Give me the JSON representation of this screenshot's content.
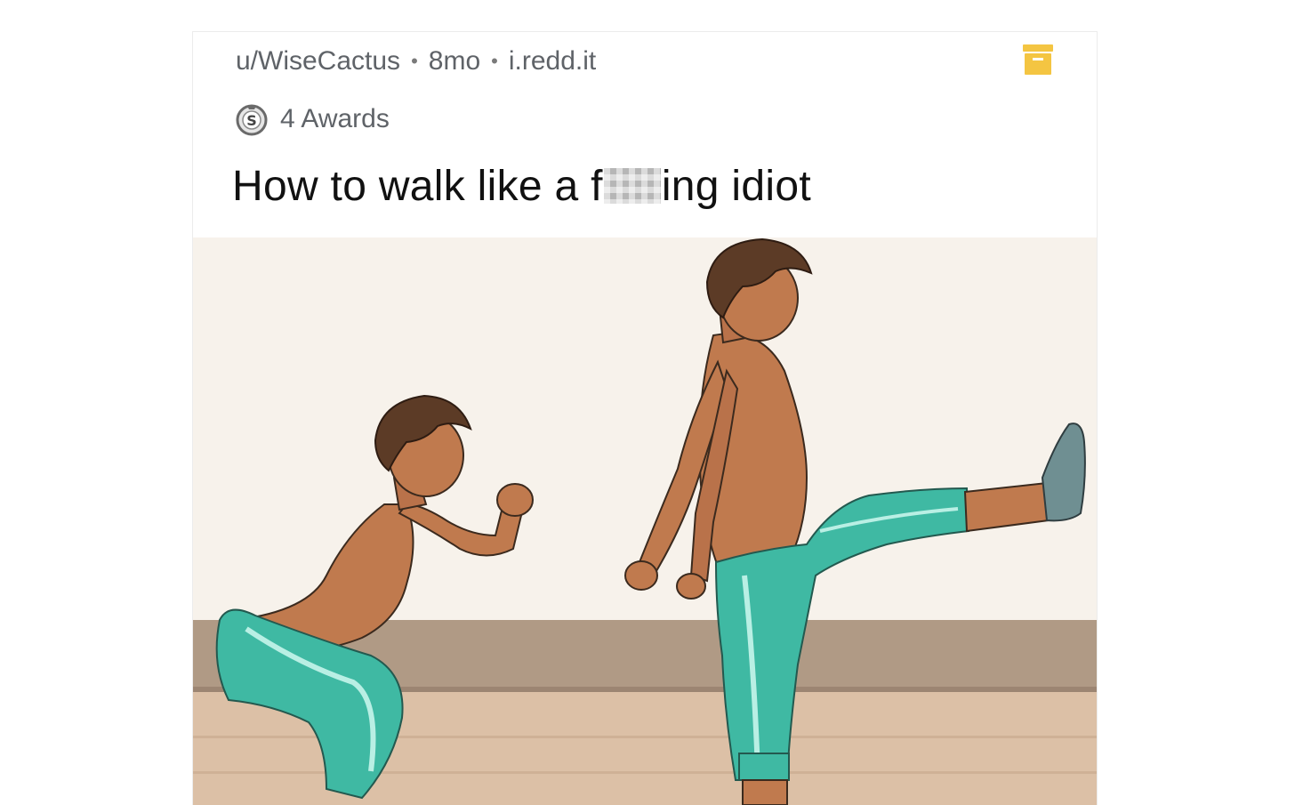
{
  "post": {
    "username": "u/WiseCactus",
    "separator": "•",
    "age": "8mo",
    "domain": "i.redd.it",
    "awards": "4 Awards",
    "title_before": "How to walk like a f",
    "title_after": "ing idiot",
    "accent_color": "#f4c542",
    "save_icon": "archive-box-icon",
    "award_icon": "silver-award-icon"
  }
}
